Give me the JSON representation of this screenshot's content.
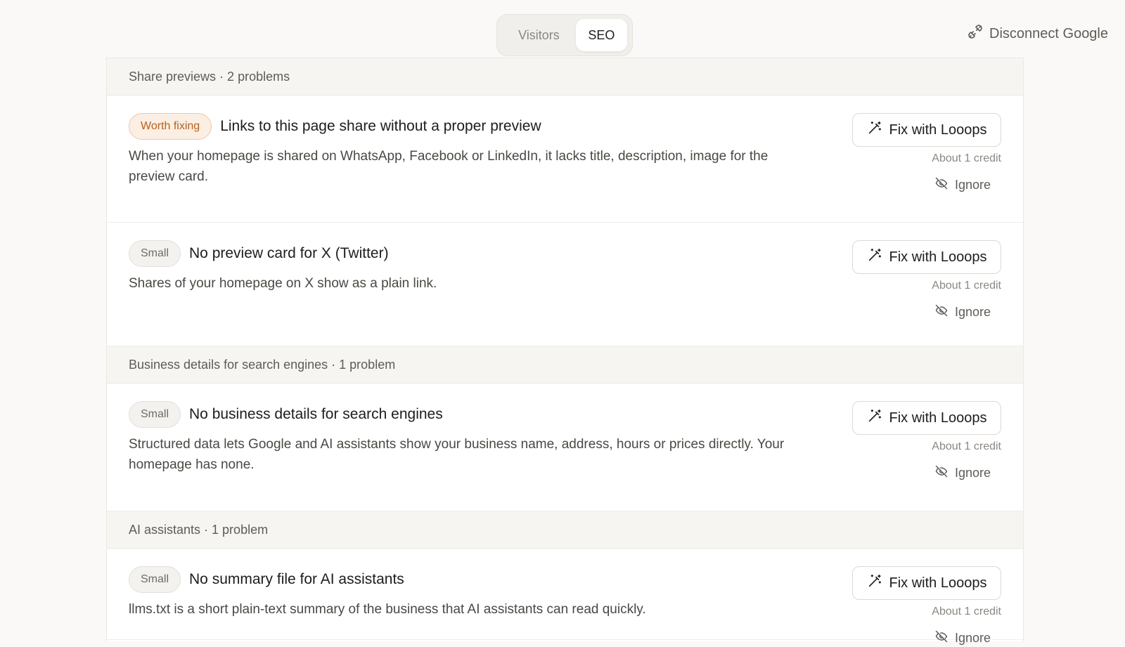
{
  "tabs": [
    {
      "label": "Visitors",
      "active": false
    },
    {
      "label": "SEO",
      "active": true
    }
  ],
  "header": {
    "disconnect_label": "Disconnect Google",
    "disconnect_icon": "plug-disconnect-icon"
  },
  "groups": [
    {
      "heading": "Share previews · 2 problems",
      "issues": [
        {
          "badge": "Worth fixing",
          "badge_kind": "worth",
          "title": "Links to this page share without a proper preview",
          "description": "When your homepage is shared on WhatsApp, Facebook or LinkedIn, it lacks title, description, image for the preview card.",
          "fix_label": "Fix with Looops",
          "credit": "About 1 credit",
          "ignore_label": "Ignore"
        },
        {
          "badge": "Small",
          "badge_kind": "small",
          "title": "No preview card for X (Twitter)",
          "description": "Shares of your homepage on X show as a plain link.",
          "fix_label": "Fix with Looops",
          "credit": "About 1 credit",
          "ignore_label": "Ignore"
        }
      ]
    },
    {
      "heading": "Business details for search engines · 1 problem",
      "issues": [
        {
          "badge": "Small",
          "badge_kind": "small",
          "title": "No business details for search engines",
          "description": "Structured data lets Google and AI assistants show your business name, address, hours or prices directly. Your homepage has none.",
          "fix_label": "Fix with Looops",
          "credit": "About 1 credit",
          "ignore_label": "Ignore"
        }
      ]
    },
    {
      "heading": "AI assistants · 1 problem",
      "issues": [
        {
          "badge": "Small",
          "badge_kind": "small",
          "title": "No summary file for AI assistants",
          "description": "llms.txt is a short plain-text summary of the business that AI assistants can read quickly.",
          "fix_label": "Fix with Looops",
          "credit": "About 1 credit",
          "ignore_label": "Ignore"
        }
      ]
    }
  ],
  "colors": {
    "worth_badge_text": "#b5621d",
    "worth_badge_bg": "#fbeee3",
    "page_bg": "#faf9f7"
  }
}
